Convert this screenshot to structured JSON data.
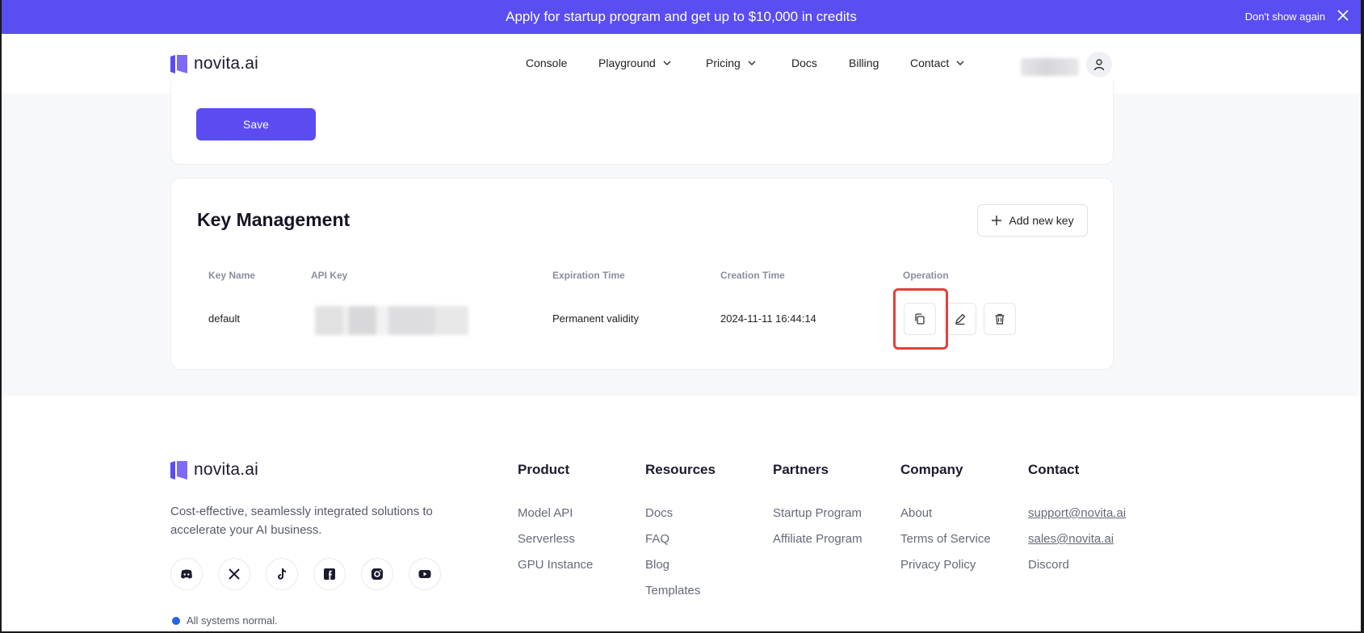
{
  "banner": {
    "text": "Apply for startup program and get up to $10,000 in credits",
    "dont_show": "Don't show again"
  },
  "brand": {
    "name": "novita.ai",
    "color": "#5b4cf1"
  },
  "nav": {
    "console": "Console",
    "playground": "Playground",
    "pricing": "Pricing",
    "docs": "Docs",
    "billing": "Billing",
    "contact": "Contact"
  },
  "settings": {
    "save_label": "Save"
  },
  "keys": {
    "title": "Key Management",
    "add_label": "Add new key",
    "headers": {
      "name": "Key Name",
      "api_key": "API Key",
      "expiration": "Expiration Time",
      "creation": "Creation Time",
      "operation": "Operation"
    },
    "rows": [
      {
        "name": "default",
        "expiration": "Permanent validity",
        "creation": "2024-11-11 16:44:14"
      }
    ]
  },
  "footer": {
    "tagline": "Cost-effective, seamlessly integrated solutions to accelerate your AI business.",
    "status": "All systems normal.",
    "social_icons": [
      "discord-icon",
      "x-icon",
      "tiktok-icon",
      "facebook-icon",
      "instagram-icon",
      "youtube-icon"
    ],
    "columns": {
      "product": {
        "title": "Product",
        "links": [
          "Model API",
          "Serverless",
          "GPU Instance"
        ]
      },
      "resources": {
        "title": "Resources",
        "links": [
          "Docs",
          "FAQ",
          "Blog",
          "Templates"
        ]
      },
      "partners": {
        "title": "Partners",
        "links": [
          "Startup Program",
          "Affiliate Program"
        ]
      },
      "company": {
        "title": "Company",
        "links": [
          "About",
          "Terms of Service",
          "Privacy Policy"
        ]
      },
      "contact": {
        "title": "Contact",
        "links": [
          "support@novita.ai",
          "sales@novita.ai",
          "Discord"
        ]
      }
    }
  }
}
